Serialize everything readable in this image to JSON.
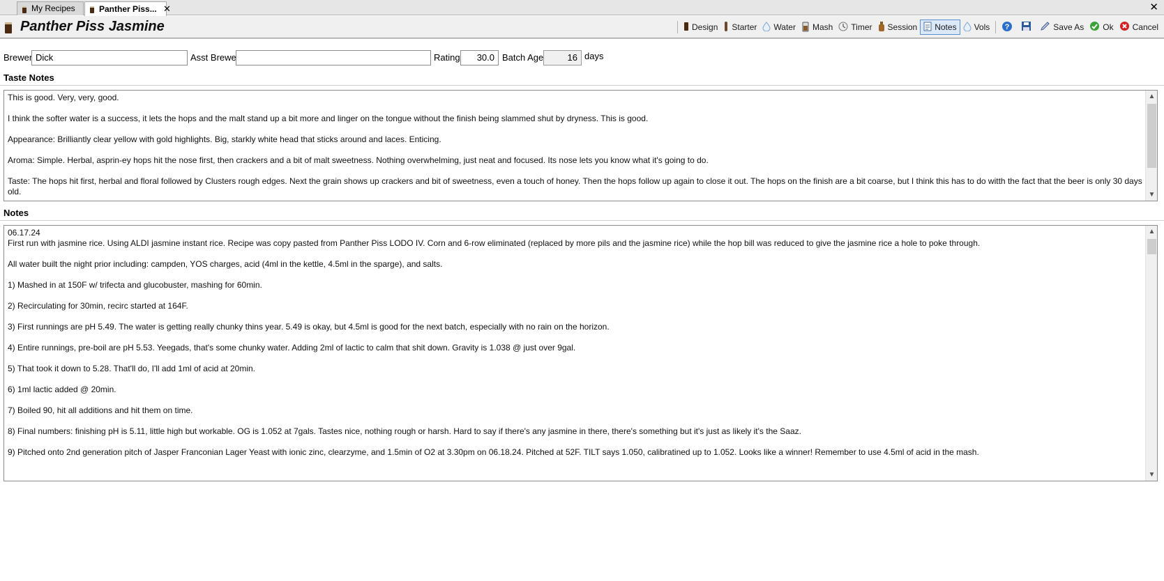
{
  "tabs": [
    {
      "label": "My Recipes",
      "active": false
    },
    {
      "label": "Panther Piss...",
      "active": true
    }
  ],
  "window_close": "✕",
  "tab_close": "✕",
  "recipe_title": "Panther Piss Jasmine",
  "toolbar": {
    "design": "Design",
    "starter": "Starter",
    "water": "Water",
    "mash": "Mash",
    "timer": "Timer",
    "session": "Session",
    "notes": "Notes",
    "vols": "Vols",
    "save_as": "Save As",
    "ok": "Ok",
    "cancel": "Cancel"
  },
  "form": {
    "brewer_label": "Brewer",
    "brewer_value": "Dick",
    "asst_brewer_label": "Asst Brewer",
    "asst_brewer_value": "",
    "rating_label": "Rating",
    "rating_value": "30.0",
    "batch_age_label": "Batch Age",
    "batch_age_value": "16",
    "batch_age_unit": "days"
  },
  "taste_notes": {
    "header": "Taste Notes",
    "paragraphs": [
      "This is good. Very, very, good.",
      "I think the softer water is a success, it lets the hops and the malt stand up a bit more and linger on the tongue without the finish being slammed shut by dryness. This is good.",
      "Appearance: Brilliantly clear yellow with gold highlights. Big, starkly white head that sticks around and laces. Enticing.",
      "Aroma: Simple. Herbal, asprin-ey hops hit the nose first, then crackers and a bit of malt sweetness. Nothing overwhelming, just neat and focused. Its nose lets you know what it's going to do.",
      "Taste: The hops hit first, herbal and floral followed by Clusters rough edges. Next the grain shows up crackers and bit of sweetness, even a touch of honey. Then the hops follow up again to close it out. The hops on the finish are a bit coarse, but I think this has to do witth the fact that the beer is only 30 days old."
    ]
  },
  "notes": {
    "header": "Notes",
    "date_line": "06.17.24",
    "paragraphs": [
      "First run with jasmine rice. Using ALDI jasmine instant rice. Recipe was copy pasted from Panther Piss LODO IV. Corn and 6-row eliminated (replaced by more pils and the jasmine rice) while the hop bill was reduced to give the jasmine rice a hole to poke through.",
      "All water built the night prior including: campden, YOS charges, acid (4ml in the kettle, 4.5ml in the sparge), and salts.",
      "1) Mashed in at 150F w/ trifecta and glucobuster, mashing for 60min.",
      "2) Recirculating for 30min, recirc started at 164F.",
      "3) First runnings are pH 5.49. The water is getting really chunky thins year. 5.49 is okay, but 4.5ml is good for the next batch, especially with no rain on the horizon.",
      "4) Entire runnings, pre-boil are pH 5.53. Yeegads, that's some chunky water. Adding 2ml of lactic to calm that shit down. Gravity is 1.038 @ just over 9gal.",
      "5) That took it down to 5.28. That'll do, I'll add 1ml of acid at 20min.",
      "6) 1ml lactic added @ 20min.",
      "7) Boiled 90, hit all additions and hit them on time.",
      "8) Final numbers: finishing pH is 5.11, little high but workable. OG is 1.052 at 7gals. Tastes nice, nothing rough or harsh. Hard to say if there's any jasmine in there, there's something but it's just as likely it's the Saaz.",
      "9) Pitched onto 2nd generation pitch of Jasper Franconian Lager Yeast with ionic zinc, clearzyme, and 1.5min of O2 at 3.30pm on 06.18.24. Pitched at 52F. TILT says 1.050, calibratined up to 1.052. Looks like a winner! Remember to use 4.5ml of acid in the mash."
    ]
  },
  "colors": {
    "accent": "#5a8fd0",
    "beer": "#4a2a10",
    "water_drop": "#7aa8d8",
    "ok_green": "#3aa335",
    "cancel_red": "#d42020",
    "help_blue": "#2a6fd0"
  }
}
